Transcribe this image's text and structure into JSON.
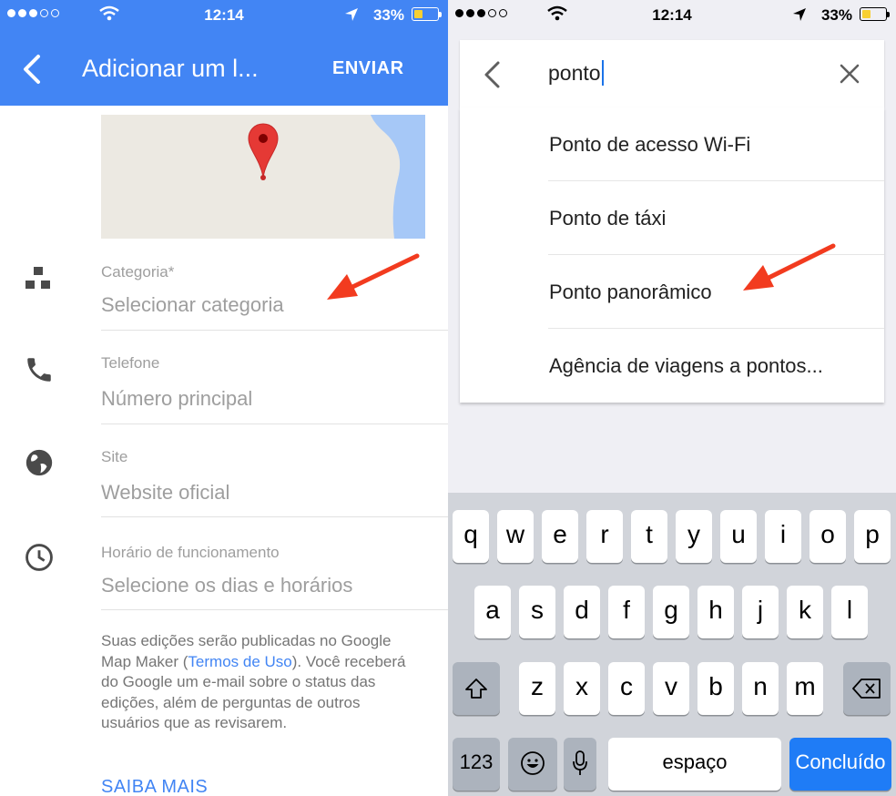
{
  "status_bar": {
    "time": "12:14",
    "battery": "33%"
  },
  "left": {
    "header": {
      "title": "Adicionar um l...",
      "send_label": "ENVIAR"
    },
    "fields": [
      {
        "label": "Categoria*",
        "placeholder": "Selecionar categoria",
        "icon": "category-icon"
      },
      {
        "label": "Telefone",
        "placeholder": "Número principal",
        "icon": "phone-icon"
      },
      {
        "label": "Site",
        "placeholder": "Website oficial",
        "icon": "globe-icon"
      },
      {
        "label": "Horário de funcionamento",
        "placeholder": "Selecione os dias e horários",
        "icon": "clock-icon"
      }
    ],
    "notice": {
      "text_before": "Suas edições serão publicadas no Google Map Maker (",
      "link": "Termos de Uso",
      "text_after": "). Você receberá do Google um e-mail sobre o status das edições, além de perguntas de outros usuários que as revisarem."
    },
    "more_link": "SAIBA MAIS"
  },
  "right": {
    "search": {
      "query": "ponto"
    },
    "suggestions": [
      "Ponto de acesso Wi-Fi",
      "Ponto de táxi",
      "Ponto panorâmico",
      "Agência de viagens a pontos..."
    ],
    "keyboard": {
      "row1": [
        "q",
        "w",
        "e",
        "r",
        "t",
        "y",
        "u",
        "i",
        "o",
        "p"
      ],
      "row2": [
        "a",
        "s",
        "d",
        "f",
        "g",
        "h",
        "j",
        "k",
        "l"
      ],
      "row3": [
        "z",
        "x",
        "c",
        "v",
        "b",
        "n",
        "m"
      ],
      "numbers_label": "123",
      "space_label": "espaço",
      "done_label": "Concluído"
    }
  },
  "colors": {
    "accent": "#4285f4",
    "pin": "#e53935",
    "arrow": "#f23b1f",
    "done_key": "#1f7cf6"
  }
}
